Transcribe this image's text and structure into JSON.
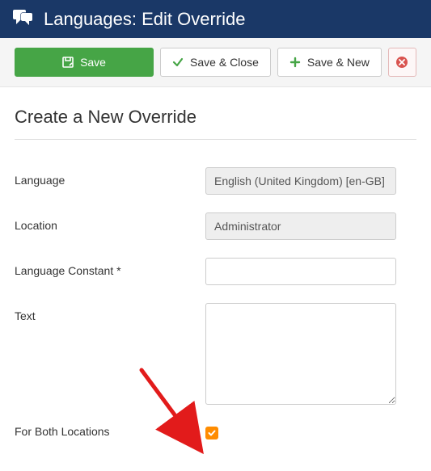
{
  "header": {
    "title": "Languages: Edit Override"
  },
  "toolbar": {
    "save_label": "Save",
    "save_close_label": "Save & Close",
    "save_new_label": "Save & New"
  },
  "form": {
    "section_title": "Create a New Override",
    "fields": {
      "language": {
        "label": "Language",
        "value": "English (United Kingdom) [en-GB]"
      },
      "location": {
        "label": "Location",
        "value": "Administrator"
      },
      "constant": {
        "label": "Language Constant *",
        "value": ""
      },
      "text": {
        "label": "Text",
        "value": ""
      },
      "both": {
        "label": "For Both Locations",
        "checked": true
      }
    }
  },
  "colors": {
    "header_bg": "#1a3867",
    "save_btn": "#46a546",
    "checkbox": "#ff8c00",
    "arrow": "#e21b1b"
  }
}
